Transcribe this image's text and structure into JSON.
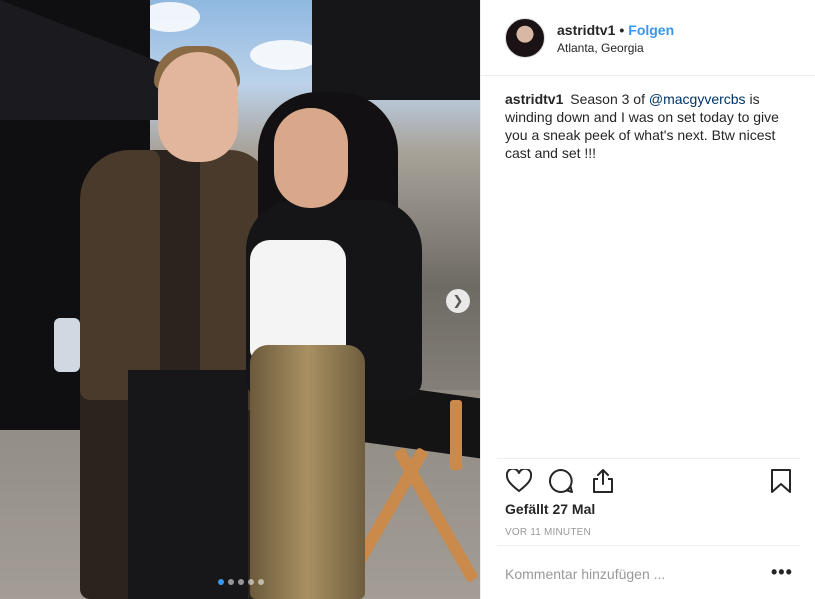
{
  "post": {
    "carousel": {
      "total_slides": 5,
      "active_index": 0,
      "next_icon": "chevron-right-icon"
    },
    "author": {
      "username": "astridtv1",
      "separator": "•",
      "follow_label": "Folgen",
      "location": "Atlanta, Georgia"
    },
    "caption": {
      "username": "astridtv1",
      "text_before": "Season 3 of ",
      "mention": "@macgyvercbs",
      "text_after": " is winding down and I was on set today to give you a sneak peek of what's next. Btw nicest cast and set !!!"
    },
    "actions": {
      "like_icon": "heart-icon",
      "comment_icon": "comment-bubble-icon",
      "share_icon": "share-icon",
      "save_icon": "bookmark-icon"
    },
    "likes_text": "Gefällt 27 Mal",
    "timestamp": "VOR 11 MINUTEN",
    "comment": {
      "placeholder": "Kommentar hinzufügen ...",
      "value": ""
    },
    "more_label": "•••"
  },
  "colors": {
    "accent": "#3897f0",
    "text": "#262626",
    "muted": "#999999",
    "divider": "#efefef"
  }
}
